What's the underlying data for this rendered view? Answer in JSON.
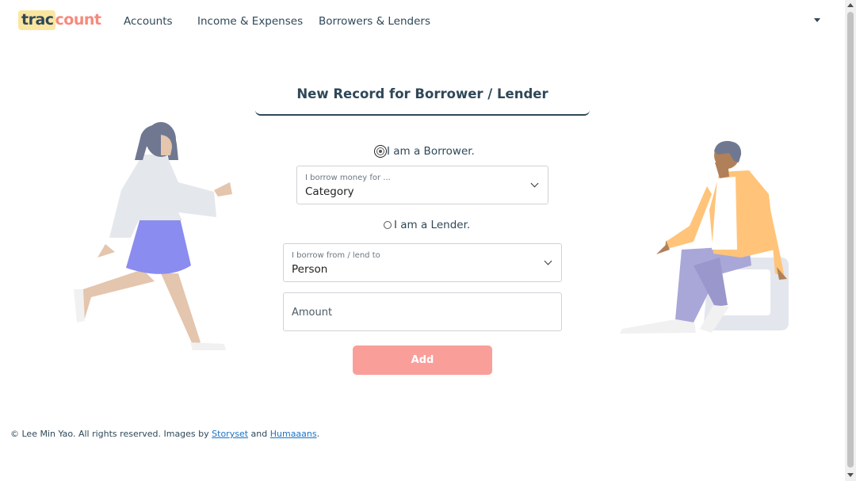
{
  "brand": {
    "highlight": "trac",
    "rest": "count"
  },
  "nav": {
    "links": [
      "Accounts",
      "Income & Expenses",
      "Borrowers & Lenders"
    ],
    "dropdown_icon": "caret-down-icon"
  },
  "form": {
    "title": "New Record for Borrower / Lender",
    "borrower_option": {
      "label": "I am a Borrower.",
      "checked": true
    },
    "category_select": {
      "floating_label": "I borrow money for ...",
      "value": "Category"
    },
    "lender_option": {
      "label": "I am a Lender.",
      "checked": false
    },
    "person_select": {
      "floating_label": "I borrow from / lend to",
      "value": "Person"
    },
    "amount": {
      "placeholder": "Amount"
    },
    "submit_label": "Add"
  },
  "footer": {
    "prefix": "© Lee Min Yao. All rights reserved. Images by ",
    "link1": "Storyset",
    "middle": " and ",
    "link2": "Humaaans",
    "suffix": "."
  },
  "colors": {
    "primary_text": "#2f4858",
    "brand_highlight": "#fbe6a0",
    "brand_accent": "#f58a7c",
    "button": "#fa9e9a"
  }
}
